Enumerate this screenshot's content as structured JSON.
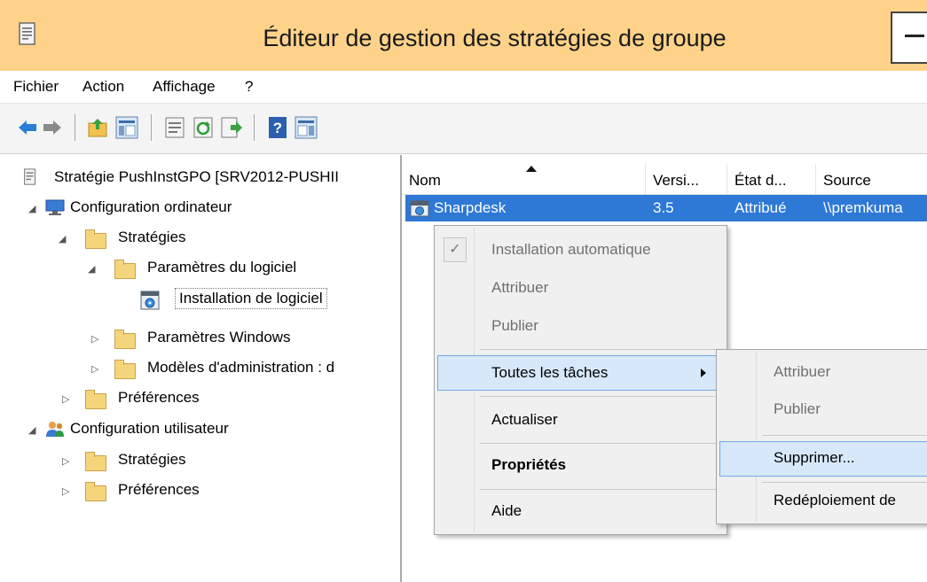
{
  "window": {
    "title": "Éditeur de gestion des stratégies de groupe",
    "app_icon": "gpo-editor-icon",
    "titlebar_color": "#ffd28a"
  },
  "menu": {
    "file": "Fichier",
    "action": "Action",
    "view": "Affichage",
    "help": "?"
  },
  "toolbar": {
    "icons": [
      "back-arrow-icon",
      "forward-arrow-icon",
      "up-folder-icon",
      "show-hide-tree-icon",
      "properties-icon",
      "refresh-icon",
      "export-list-icon",
      "help-icon",
      "action-pane-icon"
    ]
  },
  "tree": {
    "root": "Stratégie PushInstGPO [SRV2012-PUSHII",
    "computer_config": "Configuration ordinateur",
    "computer_policies": "Stratégies",
    "software_settings": "Paramètres du logiciel",
    "software_installation": "Installation de logiciel",
    "windows_settings": "Paramètres Windows",
    "admin_templates": "Modèles d'administration : d",
    "computer_preferences": "Préférences",
    "user_config": "Configuration utilisateur",
    "user_policies": "Stratégies",
    "user_preferences": "Préférences"
  },
  "list": {
    "columns": {
      "name": "Nom",
      "version": "Versi...",
      "state": "État d...",
      "source": "Source"
    },
    "rows": [
      {
        "name": "Sharpdesk",
        "version": "3.5",
        "state": "Attribué",
        "source": "\\\\premkuma"
      }
    ],
    "selection_color": "#2e78d6"
  },
  "context_menu": {
    "auto_install": "Installation automatique",
    "auto_install_check": "✓",
    "assign": "Attribuer",
    "publish": "Publier",
    "all_tasks": "Toutes les tâches",
    "refresh": "Actualiser",
    "properties": "Propriétés",
    "help": "Aide"
  },
  "submenu": {
    "assign": "Attribuer",
    "publish": "Publier",
    "remove": "Supprimer...",
    "redeploy": "Redéploiement de"
  }
}
